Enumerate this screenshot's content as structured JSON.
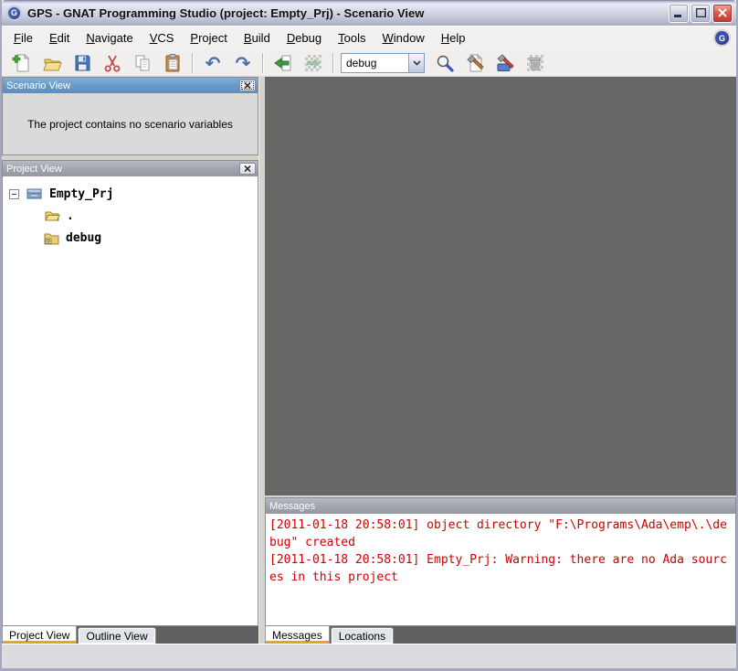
{
  "window": {
    "title": "GPS - GNAT Programming Studio (project: Empty_Prj) - Scenario View",
    "logo_letter": "G"
  },
  "menu": {
    "items": [
      {
        "label": "File",
        "mnemonic": "F"
      },
      {
        "label": "Edit",
        "mnemonic": "E"
      },
      {
        "label": "Navigate",
        "mnemonic": "N"
      },
      {
        "label": "VCS",
        "mnemonic": "V"
      },
      {
        "label": "Project",
        "mnemonic": "P"
      },
      {
        "label": "Build",
        "mnemonic": "B"
      },
      {
        "label": "Debug",
        "mnemonic": "D"
      },
      {
        "label": "Tools",
        "mnemonic": "T"
      },
      {
        "label": "Window",
        "mnemonic": "W"
      },
      {
        "label": "Help",
        "mnemonic": "H"
      }
    ]
  },
  "toolbar": {
    "items": [
      {
        "name": "new-file"
      },
      {
        "name": "open-folder"
      },
      {
        "name": "save"
      },
      {
        "name": "cut"
      },
      {
        "name": "copy"
      },
      {
        "name": "paste"
      },
      {
        "separator": true
      },
      {
        "name": "undo"
      },
      {
        "name": "redo"
      },
      {
        "separator": true
      },
      {
        "name": "navigate-back"
      },
      {
        "name": "navigate-forward",
        "enabled": false
      },
      {
        "separator": true
      },
      {
        "combo": true
      },
      {
        "name": "search"
      },
      {
        "name": "build-main"
      },
      {
        "name": "custom-build"
      },
      {
        "name": "clean",
        "enabled": false
      }
    ],
    "build_mode": {
      "value": "debug"
    }
  },
  "scenario_view": {
    "title": "Scenario View",
    "empty_text": "The project contains no scenario variables"
  },
  "project_view": {
    "title": "Project View",
    "tree": {
      "root": {
        "label": "Empty_Prj",
        "icon": "project-icon",
        "expanded": true
      },
      "children": [
        {
          "label": ".",
          "icon": "open-folder-icon"
        },
        {
          "label": "debug",
          "icon": "object-folder-icon"
        }
      ]
    }
  },
  "left_tab_bar": {
    "tabs": [
      {
        "label": "Project View",
        "active": true
      },
      {
        "label": "Outline View",
        "active": false
      }
    ]
  },
  "messages_view": {
    "title": "Messages",
    "entries": [
      "[2011-01-18 20:58:01] object directory \"F:\\Programs\\Ada\\emp\\.\\debug\" created",
      "[2011-01-18 20:58:01] Empty_Prj: Warning: there are no Ada sources in this project"
    ]
  },
  "bottom_tab_bar": {
    "tabs": [
      {
        "label": "Messages",
        "active": true
      },
      {
        "label": "Locations",
        "active": false
      }
    ]
  },
  "colors": {
    "active_panel_title": "#6b9cc9",
    "inactive_panel_title": "#a2a5ad",
    "editor_background": "#666666",
    "message_text": "#cc0000",
    "tab_active_underline": "#efa023"
  }
}
